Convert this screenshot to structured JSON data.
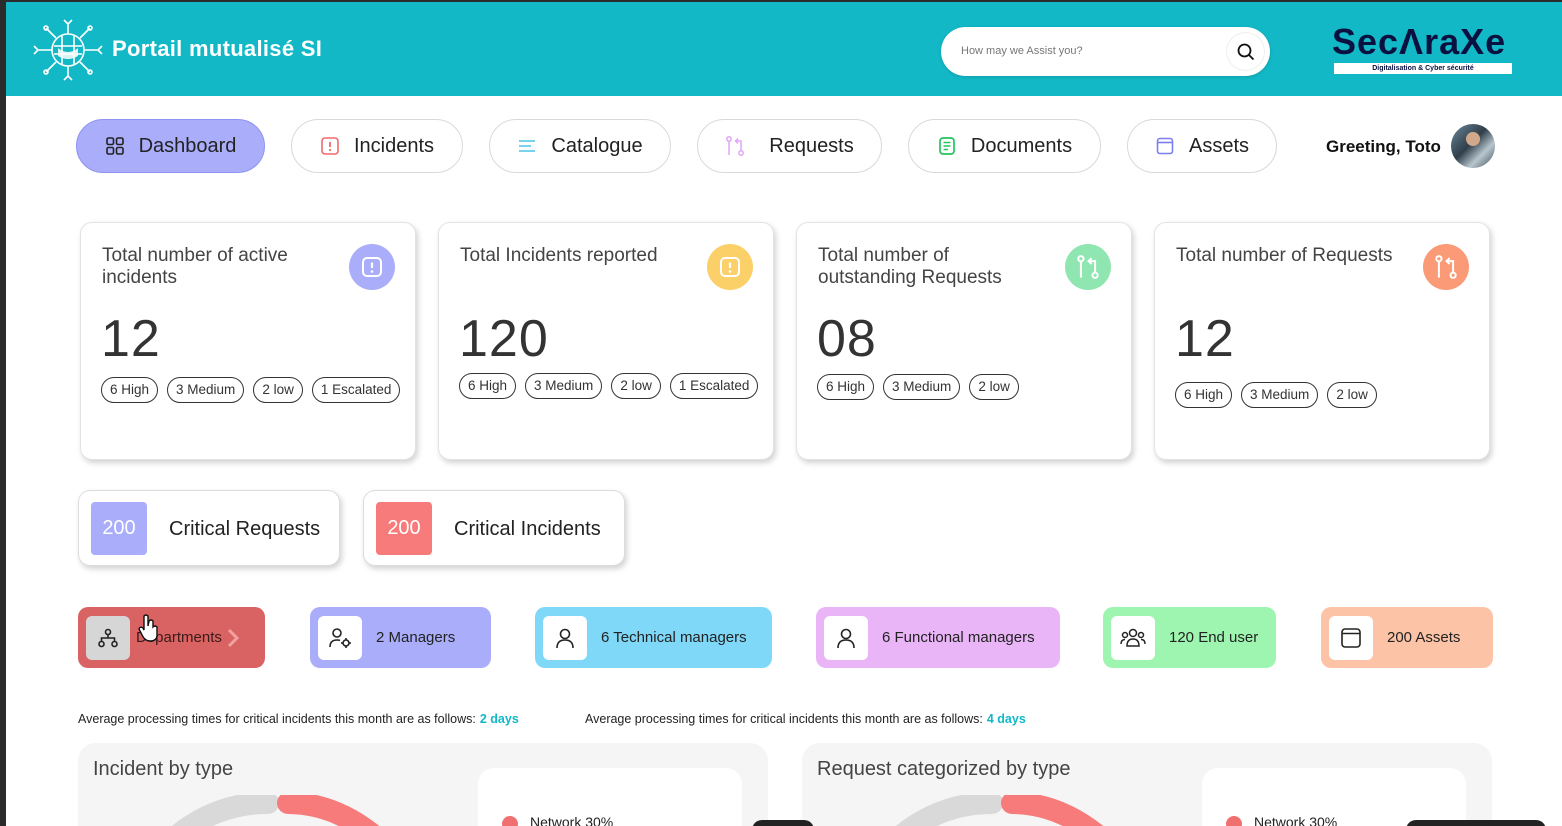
{
  "app": {
    "title": "Portail mutualisé SI",
    "brand": "SecɅraXe",
    "brand_tagline": "Digitalisation & Cyber sécurité",
    "accent_color": "#12b8c6"
  },
  "search": {
    "placeholder": "How may we Assist you?",
    "icon": "search-icon"
  },
  "nav": {
    "items": [
      {
        "label": "Dashboard",
        "icon": "grid-icon",
        "active": true
      },
      {
        "label": "Incidents",
        "icon": "alert-square-icon",
        "active": false
      },
      {
        "label": "Catalogue",
        "icon": "lines-icon",
        "active": false
      },
      {
        "label": "Requests",
        "icon": "pull-request-icon",
        "active": false
      },
      {
        "label": "Documents",
        "icon": "document-icon",
        "active": false
      },
      {
        "label": "Assets",
        "icon": "window-icon",
        "active": false
      }
    ],
    "greeting": "Greeting, Toto"
  },
  "cards": [
    {
      "title": "Total number of active incidents",
      "value": "12",
      "tags": [
        "6 High",
        "3 Medium",
        "2 low",
        "1 Escalated"
      ],
      "icon": "alert-icon",
      "icon_color": "#a9adfa"
    },
    {
      "title": "Total Incidents reported",
      "value": "120",
      "tags": [
        "6 High",
        "3 Medium",
        "2 low",
        "1 Escalated"
      ],
      "icon": "alert-icon",
      "icon_color": "#fbd068"
    },
    {
      "title": "Total number of outstanding Requests",
      "value": "08",
      "tags": [
        "6 High",
        "3 Medium",
        "2 low"
      ],
      "icon": "pull-request-icon",
      "icon_color": "#8fe6b0"
    },
    {
      "title": "Total number of Requests",
      "value": "12",
      "tags": [
        "6 High",
        "3 Medium",
        "2 low"
      ],
      "icon": "pull-request-icon",
      "icon_color": "#fb9a76"
    }
  ],
  "critical": [
    {
      "value": "200",
      "label": "Critical Requests",
      "color": "#a9adfa"
    },
    {
      "value": "200",
      "label": "Critical Incidents",
      "color": "#f77b7b"
    }
  ],
  "chips": [
    {
      "label": "Departments",
      "icon": "hierarchy-icon",
      "color": "#d96363"
    },
    {
      "label": "2 Managers",
      "icon": "user-gear-icon",
      "color": "#a9adfa"
    },
    {
      "label": "6 Technical managers",
      "icon": "user-icon",
      "color": "#7fd8f8"
    },
    {
      "label": "6 Functional managers",
      "icon": "user-icon",
      "color": "#e9b5f7"
    },
    {
      "label": "120 End user",
      "icon": "users-icon",
      "color": "#9ef5b0"
    },
    {
      "label": "200 Assets",
      "icon": "window-icon",
      "color": "#fcc3a6"
    }
  ],
  "averages": [
    {
      "text": "Average processing times for critical incidents this month are as follows:",
      "value": "2 days"
    },
    {
      "text": "Average processing times for critical incidents this month are as follows:",
      "value": "4 days"
    }
  ],
  "panels": [
    {
      "title": "Incident by type",
      "legend": "Network 30%"
    },
    {
      "title": "Request categorized by type",
      "legend": "Network 30%"
    }
  ]
}
